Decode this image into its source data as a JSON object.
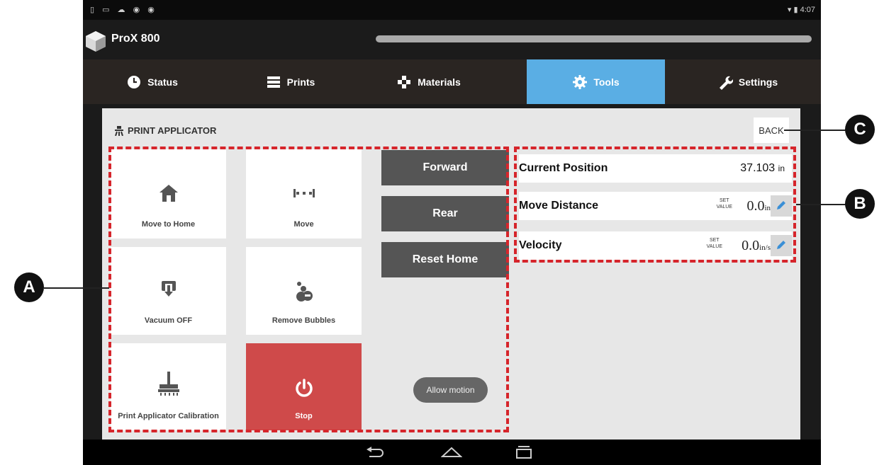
{
  "statusbar": {
    "left_icons": "▯ ▭ ☁ ◉ ◉",
    "time": "4:07"
  },
  "app": {
    "name": "ProX 800"
  },
  "tabs": [
    {
      "label": "Status",
      "icon": "clock-icon"
    },
    {
      "label": "Prints",
      "icon": "list-icon"
    },
    {
      "label": "Materials",
      "icon": "checker-icon"
    },
    {
      "label": "Tools",
      "icon": "gear-icon",
      "active": true
    },
    {
      "label": "Settings",
      "icon": "wrench-icon"
    }
  ],
  "panel": {
    "title": "PRINT APPLICATOR",
    "back": "BACK"
  },
  "tiles": [
    {
      "label": "Move to Home",
      "icon": "home-icon"
    },
    {
      "label": "Move",
      "icon": "move-icon"
    },
    {
      "label": "Vacuum OFF",
      "icon": "vacuum-icon"
    },
    {
      "label": "Remove Bubbles",
      "icon": "bubbles-icon"
    },
    {
      "label": "Print Applicator Calibration",
      "icon": "brush-icon"
    },
    {
      "label": "Stop",
      "icon": "power-icon"
    }
  ],
  "buttons": {
    "forward": "Forward",
    "rear": "Rear",
    "reset_home": "Reset Home",
    "allow_motion": "Allow motion"
  },
  "fields": {
    "current_position": {
      "label": "Current Position",
      "value": "37.103",
      "unit": "in"
    },
    "move_distance": {
      "label": "Move Distance",
      "set_top": "SET",
      "set_bottom": "VALUE",
      "value": "0.0",
      "unit": "in"
    },
    "velocity": {
      "label": "Velocity",
      "set_top": "SET",
      "set_bottom": "VALUE",
      "value": "0.0",
      "unit": "in/s"
    }
  },
  "callouts": {
    "a": "A",
    "b": "B",
    "c": "C"
  },
  "colors": {
    "active_tab": "#5aaee4",
    "stop": "#cf4a4a",
    "dash": "#d6252b"
  }
}
